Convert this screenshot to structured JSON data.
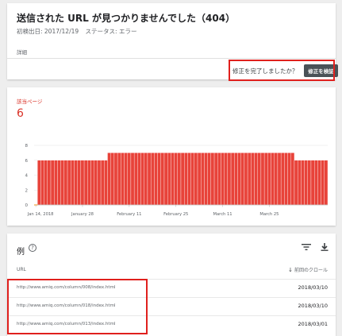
{
  "header": {
    "title": "送信された URL が見つかりませんでした（404）",
    "first_detected": "初検出日: 2017/12/19",
    "status": "ステータス: エラー",
    "details_label": "詳細",
    "fix_question": "修正を完了しましたか？",
    "validate_button": "修正を検証"
  },
  "chart": {
    "label": "該当ページ",
    "count": "6"
  },
  "chart_data": {
    "type": "bar",
    "ylabel": "",
    "xlabel": "",
    "ylim": [
      0,
      8
    ],
    "yticks": [
      "0",
      "2",
      "4",
      "6",
      "8"
    ],
    "xtick_labels": [
      "Jan 14, 2018",
      "January 28",
      "February 11",
      "February 25",
      "March 11",
      "March 25"
    ],
    "xtick_index": [
      0,
      14,
      28,
      42,
      56,
      70
    ],
    "values": [
      0,
      6,
      6,
      6,
      6,
      6,
      6,
      6,
      6,
      6,
      6,
      6,
      6,
      6,
      6,
      6,
      6,
      6,
      6,
      6,
      6,
      6,
      7,
      7,
      7,
      7,
      7,
      7,
      7,
      7,
      7,
      7,
      7,
      7,
      7,
      7,
      7,
      7,
      7,
      7,
      7,
      7,
      7,
      7,
      7,
      7,
      7,
      7,
      7,
      7,
      7,
      7,
      7,
      7,
      7,
      7,
      7,
      7,
      7,
      7,
      7,
      7,
      7,
      7,
      7,
      7,
      7,
      7,
      7,
      7,
      7,
      7,
      7,
      7,
      7,
      7,
      7,
      7,
      6,
      6,
      6,
      6,
      6,
      6,
      6,
      6,
      6,
      6
    ],
    "bar_color": "#e8433a",
    "grid": true
  },
  "examples": {
    "title": "例",
    "help_icon": "?",
    "col_url": "URL",
    "col_crawl": "前回のクロール",
    "sort_arrow": "↓",
    "rows": [
      {
        "url": "http://www.amiq.com/column/008/index.html",
        "date": "2018/03/10"
      },
      {
        "url": "http://www.amiq.com/column/018/index.html",
        "date": "2018/03/10"
      },
      {
        "url": "http://www.amiq.com/column/013/index.html",
        "date": "2018/03/01"
      }
    ]
  },
  "colors": {
    "error_red": "#d93025",
    "highlight_red": "#e0201d",
    "button_dark": "#4a5257"
  }
}
